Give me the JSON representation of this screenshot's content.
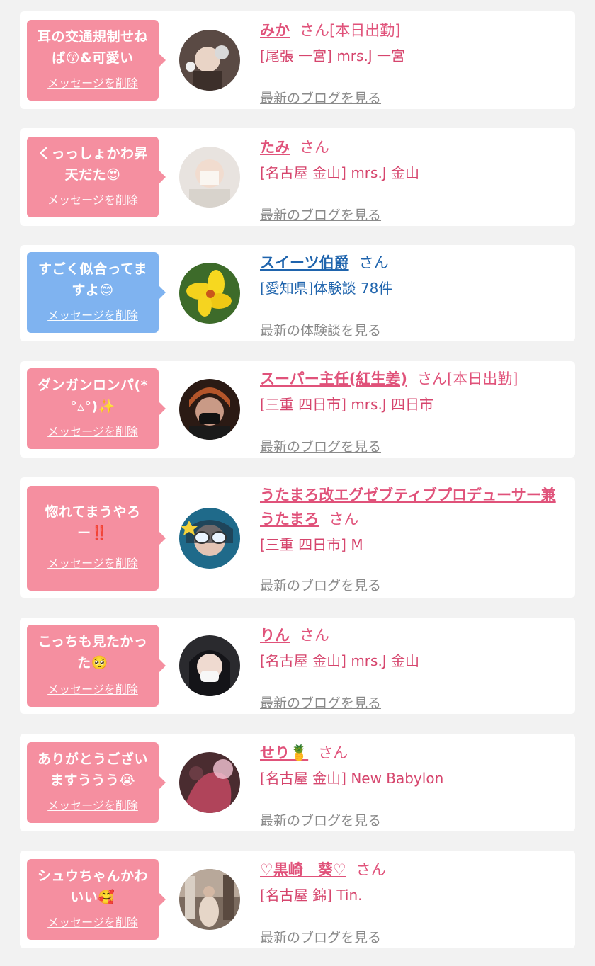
{
  "colors": {
    "bubble_pink": "#f58fa0",
    "bubble_blue": "#7fb3f0",
    "name_pink": "#e0527a",
    "name_blue": "#1f64ad",
    "link_gray": "#8a8a8a",
    "background": "#f2f2f2"
  },
  "delete_label": "メッセージを削除",
  "suffix_label": "さん",
  "messages": [
    {
      "bubble_color": "pink",
      "message": "耳の交通規制せね\nば😙&可愛い",
      "name": "みか",
      "status": "[本日出勤]",
      "area": "[尾張 一宮] mrs.J 一宮",
      "link": "最新のブログを見る",
      "name_color": "pink"
    },
    {
      "bubble_color": "pink",
      "message": "くっっしょかわ昇\n天だた😍",
      "name": "たみ",
      "status": "",
      "area": "[名古屋 金山] mrs.J 金山",
      "link": "最新のブログを見る",
      "name_color": "pink"
    },
    {
      "bubble_color": "blue",
      "message": "すごく似合ってま\nすよ😊",
      "name": "スイーツ伯爵",
      "status": "",
      "area": "[愛知県]体験談 78件",
      "link": "最新の体験談を見る",
      "name_color": "blue"
    },
    {
      "bubble_color": "pink",
      "message": "ダンガンロンパ(*\n°▵°)✨",
      "name": "スーパー主任(紅生姜)",
      "status": "[本日出勤]",
      "area": "[三重 四日市] mrs.J 四日市",
      "link": "最新のブログを見る",
      "name_color": "pink"
    },
    {
      "bubble_color": "pink",
      "message": "惚れてまうやろ\nー‼️",
      "name": "うたまろ改エグゼブティブプロデューサー兼うたまろ",
      "status": "",
      "area": "[三重 四日市] M",
      "link": "最新のブログを見る",
      "name_color": "pink"
    },
    {
      "bubble_color": "pink",
      "message": "こっちも見たかっ\nた🥺",
      "name": "りん",
      "status": "",
      "area": "[名古屋 金山] mrs.J 金山",
      "link": "最新のブログを見る",
      "name_color": "pink"
    },
    {
      "bubble_color": "pink",
      "message": "ありがとうござい\nますううう😭",
      "name": "せり🍍",
      "status": "",
      "area": "[名古屋 金山] New Babylon",
      "link": "最新のブログを見る",
      "name_color": "pink"
    },
    {
      "bubble_color": "pink",
      "message": "シュウちゃんかわ\nいい🥰",
      "name": "♡黒崎　葵♡",
      "status": "",
      "area": "[名古屋 錦] Tin.",
      "link": "最新のブログを見る",
      "name_color": "pink"
    }
  ]
}
